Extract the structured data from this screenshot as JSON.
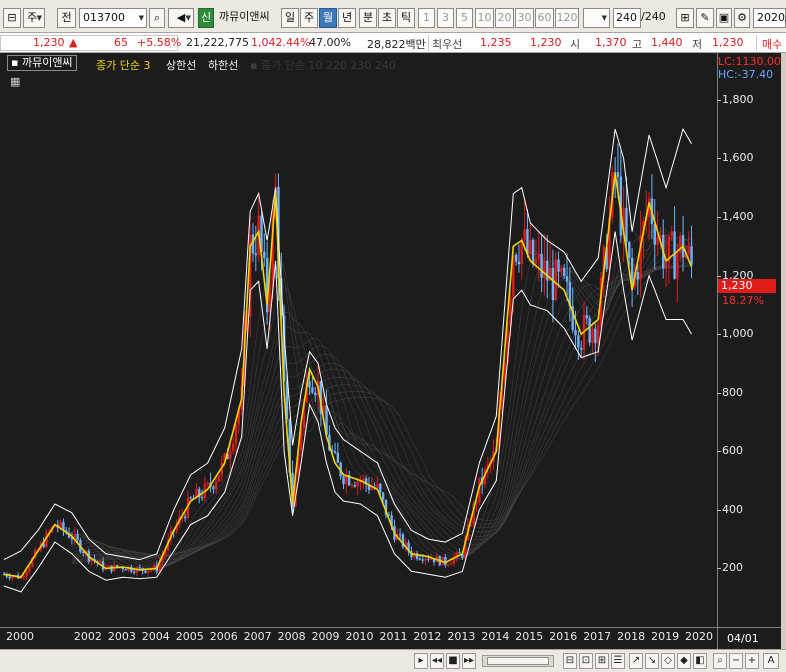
{
  "toolbar": {
    "type_code": "주",
    "prev_label": "전",
    "stock_code": "013700",
    "new_badge": "신",
    "stock_name": "까뮤이앤씨",
    "periods": [
      "일",
      "주",
      "월",
      "년",
      "분",
      "초",
      "틱"
    ],
    "selected_period": "월",
    "numbers": [
      "1",
      "3",
      "5",
      "10",
      "20",
      "30",
      "60",
      "120"
    ],
    "count": "240",
    "count_total": "/240",
    "date_partial": "2020/"
  },
  "quote": {
    "price": "1,230",
    "change_arrow": "▲",
    "change": "65",
    "change_pct": "+5.58%",
    "volume": "21,222,775",
    "volume_pct": "1,042.44%",
    "ratio": "47.00%",
    "amount": "28,822백만",
    "order_label": "최우선",
    "best_ask": "1,235",
    "best_bid": "1,230",
    "open_label": "시",
    "open": "1,370",
    "high_label": "고",
    "high": "1,440",
    "low_label": "저",
    "low": "1,230",
    "trade_label": "매수"
  },
  "legend": {
    "name": "까뮤이앤씨",
    "ma_text": "종가 단순 3",
    "upper_label": "상한선",
    "lower_label": "하한선",
    "faded_text": "종가 단순 10 220 230 240"
  },
  "axis": {
    "lc": "LC:1130.00",
    "hc": "HC:-37.40",
    "current": "1,230",
    "current_pct": "18.27%",
    "right_date": "04/01"
  },
  "colors": {
    "background": "#1c1c1c",
    "up": "#e01b1b",
    "down": "#6fb4ff",
    "ma": "#f1d600",
    "envelope": "#ffffff"
  },
  "chart_data": {
    "type": "line",
    "title": "",
    "xlabel": "",
    "ylabel": "",
    "ylim": [
      0,
      1960
    ],
    "x_ticks": [
      "2000",
      "2002",
      "2003",
      "2004",
      "2005",
      "2006",
      "2007",
      "2008",
      "2009",
      "2010",
      "2011",
      "2012",
      "2013",
      "2014",
      "2015",
      "2016",
      "2017",
      "2018",
      "2019",
      "2020"
    ],
    "y_ticks": [
      200,
      400,
      600,
      800,
      "1,000",
      "1,200",
      "1,400",
      "1,600",
      "1,800"
    ],
    "x": [
      2000.0,
      2000.5,
      2001.0,
      2001.5,
      2002.0,
      2002.5,
      2003.0,
      2003.5,
      2004.0,
      2004.5,
      2005.0,
      2005.5,
      2006.0,
      2006.5,
      2007.0,
      2007.25,
      2007.5,
      2007.75,
      2008.0,
      2008.25,
      2008.5,
      2008.75,
      2009.0,
      2009.25,
      2009.5,
      2009.75,
      2010.0,
      2010.5,
      2011.0,
      2011.5,
      2012.0,
      2012.5,
      2013.0,
      2013.5,
      2014.0,
      2014.5,
      2015.0,
      2015.25,
      2015.5,
      2016.0,
      2016.5,
      2017.0,
      2017.5,
      2018.0,
      2018.25,
      2018.5,
      2019.0,
      2019.5,
      2020.0,
      2020.25
    ],
    "series": [
      {
        "name": "종가 단순 3",
        "values": [
          180,
          170,
          260,
          350,
          310,
          240,
          200,
          205,
          195,
          200,
          330,
          430,
          470,
          560,
          780,
          1300,
          1350,
          1100,
          1480,
          800,
          420,
          700,
          880,
          820,
          650,
          560,
          520,
          500,
          470,
          320,
          250,
          240,
          220,
          250,
          480,
          600,
          1300,
          1320,
          1250,
          1200,
          1150,
          1000,
          1050,
          1550,
          1350,
          1150,
          1450,
          1250,
          1300,
          1230
        ]
      },
      {
        "name": "상한선",
        "values": [
          230,
          260,
          330,
          420,
          390,
          300,
          250,
          240,
          230,
          250,
          400,
          520,
          560,
          680,
          950,
          1420,
          1480,
          1320,
          1500,
          1000,
          620,
          800,
          940,
          900,
          760,
          680,
          640,
          600,
          560,
          420,
          330,
          300,
          290,
          320,
          560,
          720,
          1480,
          1500,
          1380,
          1320,
          1280,
          1180,
          1260,
          1700,
          1600,
          1350,
          1680,
          1500,
          1700,
          1650
        ]
      },
      {
        "name": "하한선",
        "values": [
          140,
          120,
          200,
          290,
          250,
          190,
          160,
          170,
          165,
          170,
          260,
          350,
          380,
          460,
          650,
          1150,
          1180,
          950,
          1250,
          600,
          380,
          560,
          760,
          700,
          560,
          460,
          430,
          420,
          380,
          250,
          190,
          180,
          170,
          190,
          400,
          500,
          1120,
          1150,
          1100,
          1080,
          1020,
          920,
          940,
          1350,
          1150,
          980,
          1200,
          1050,
          1050,
          1000
        ]
      }
    ]
  }
}
